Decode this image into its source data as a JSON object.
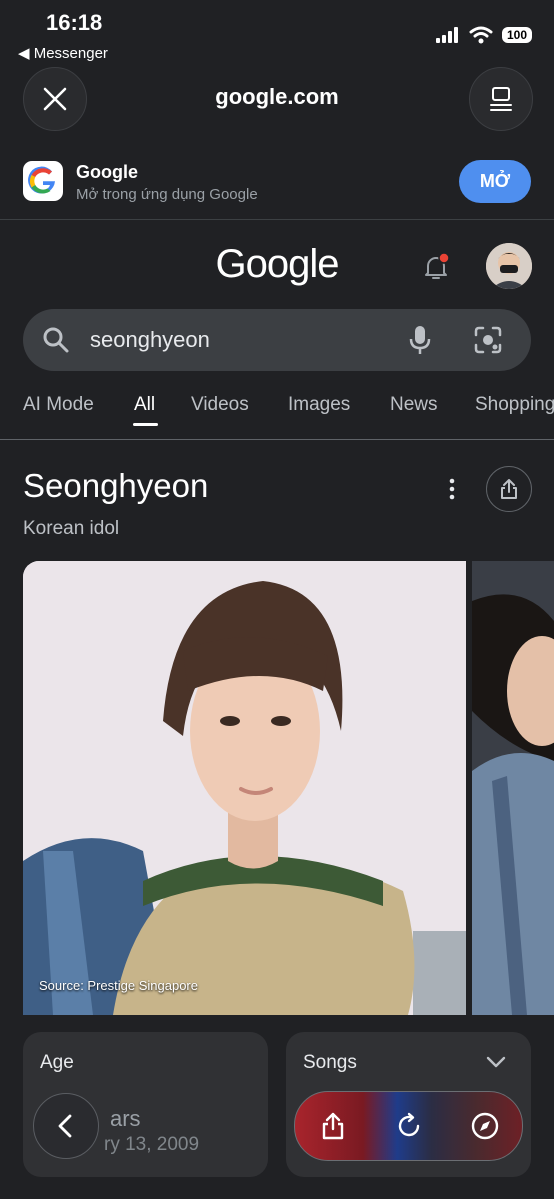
{
  "status_bar": {
    "time": "16:18",
    "back_app": "◀ Messenger",
    "battery": "100"
  },
  "nav": {
    "url": "google.com"
  },
  "app_banner": {
    "title": "Google",
    "subtitle": "Mở trong ứng dụng Google",
    "open_label": "MỞ"
  },
  "header": {
    "logo_text": "Google"
  },
  "search": {
    "query": "seonghyeon"
  },
  "tabs": [
    {
      "label": "AI Mode",
      "active": false
    },
    {
      "label": "All",
      "active": true
    },
    {
      "label": "Videos",
      "active": false
    },
    {
      "label": "Images",
      "active": false
    },
    {
      "label": "News",
      "active": false
    },
    {
      "label": "Shopping",
      "active": false
    }
  ],
  "knowledge_panel": {
    "title": "Seonghyeon",
    "subtitle": "Korean idol",
    "image_source": "Source: Prestige Singapore"
  },
  "cards": {
    "age": {
      "title": "Age",
      "value": "ars",
      "date": "ry 13, 2009"
    },
    "songs": {
      "title": "Songs"
    }
  },
  "colors": {
    "background": "#202124",
    "accent_button": "#4f8fef",
    "notification_dot": "#ea4335"
  }
}
